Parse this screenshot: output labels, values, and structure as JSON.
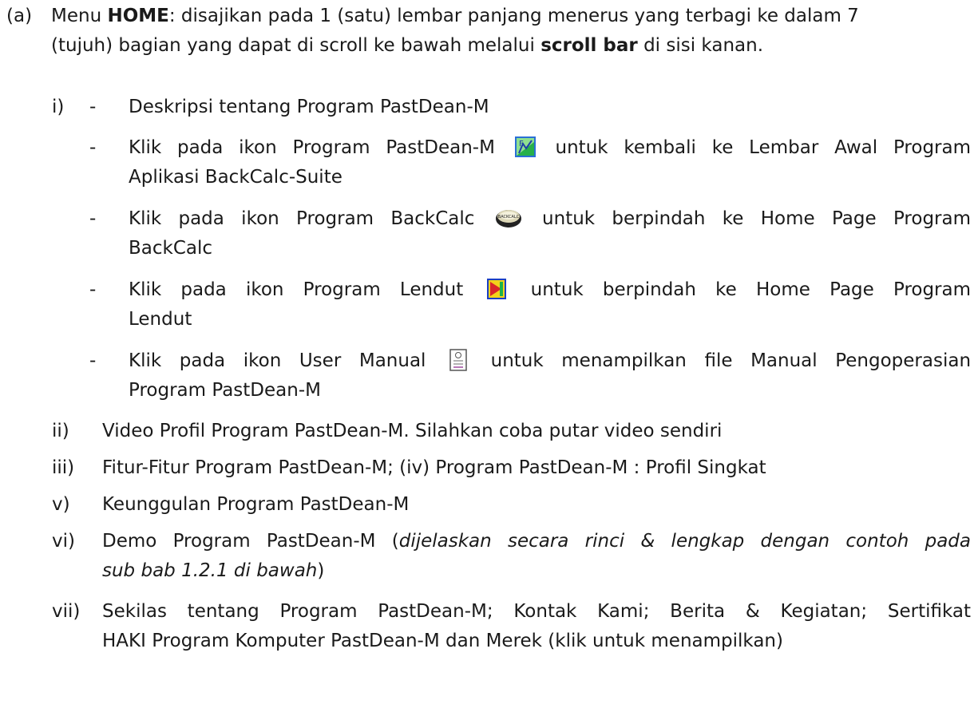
{
  "intro": {
    "label": "(a)",
    "pre": "Menu ",
    "bold": "HOME",
    "post": ":  disajikan pada 1 (satu) lembar panjang menerus yang terbagi ke dalam 7",
    "line2_pre": "(tujuh) bagian yang dapat di scroll ke bawah melalui ",
    "line2_bold": "scroll bar",
    "line2_post": " di sisi kanan."
  },
  "i": {
    "label": "i)",
    "dash": "-",
    "desc": "Deskripsi tentang Program PastDean-M",
    "b1_pre": "Klik pada ikon Program PastDean-M",
    "b1_post": "untuk kembali ke Lembar Awal Program",
    "b1_line2": "Aplikasi BackCalc-Suite",
    "b2_pre": "Klik pada ikon Program BackCalc",
    "b2_post": "untuk berpindah ke Home Page Program",
    "b2_line2": "BackCalc",
    "b3_pre": "Klik pada ikon Program Lendut",
    "b3_post": "untuk berpindah ke Home Page Program",
    "b3_line2": "Lendut",
    "b4_pre": "Klik pada ikon User Manual",
    "b4_post": "untuk menampilkan file Manual Pengoperasian",
    "b4_line2": "Program PastDean-M",
    "backcalc_icon_text": "BACKCALC"
  },
  "ii": {
    "label": "ii)",
    "text": "Video Profil Program PastDean-M.  Silahkan coba putar video sendiri"
  },
  "iii": {
    "label": "iii)",
    "text": "Fitur-Fitur Program PastDean-M;   (iv)  Program PastDean-M : Profil Singkat"
  },
  "v": {
    "label": "v)",
    "text": "Keunggulan Program PastDean-M"
  },
  "vi": {
    "label": "vi)",
    "pre": "Demo Program PastDean-M (",
    "italic": "dijelaskan secara rinci & lengkap dengan contoh pada",
    "line2_italic": "sub bab 1.2.1 di bawah",
    "line2_post": ")"
  },
  "vii": {
    "label": "vii)",
    "text": "Sekilas tentang Program PastDean-M;  Kontak Kami;  Berita & Kegiatan;  Sertifikat",
    "line2": "HAKI Program Komputer PastDean-M dan Merek (klik untuk menampilkan)"
  },
  "icons": [
    "pastdean-m-icon",
    "backcalc-icon",
    "lendut-icon",
    "user-manual-icon"
  ],
  "colors": {
    "text": "#1a1a1a",
    "pastdean_green": "#3bbf3b",
    "pastdean_blue": "#1f5fcf",
    "lendut_blue": "#1a3fc4",
    "lendut_red": "#d8262a",
    "lendut_yellow": "#f2d21b"
  }
}
